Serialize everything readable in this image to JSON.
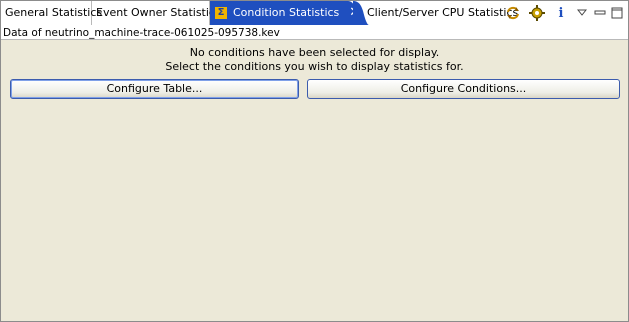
{
  "tabs": [
    {
      "label": "General Statistics"
    },
    {
      "label": "Event Owner Statistics"
    },
    {
      "label": "Condition Statistics"
    },
    {
      "label": "Client/Server CPU Statistics"
    }
  ],
  "toolbar": {
    "icons": [
      "sync-icon",
      "gear-icon",
      "info-icon",
      "view-menu-icon",
      "minimize-icon",
      "maximize-icon"
    ],
    "info_glyph": "i"
  },
  "file_line": "Data of neutrino_machine-trace-061025-095738.kev",
  "message": {
    "line1": "No conditions have been selected for display.",
    "line2": "Select the conditions you wish to display statistics for."
  },
  "buttons": {
    "configure_table": "Configure Table...",
    "configure_conditions": "Configure Conditions..."
  },
  "colors": {
    "active_tab": "#1f4fbf",
    "panel_bg": "#ece9d8",
    "button_border": "#3c5cad"
  }
}
